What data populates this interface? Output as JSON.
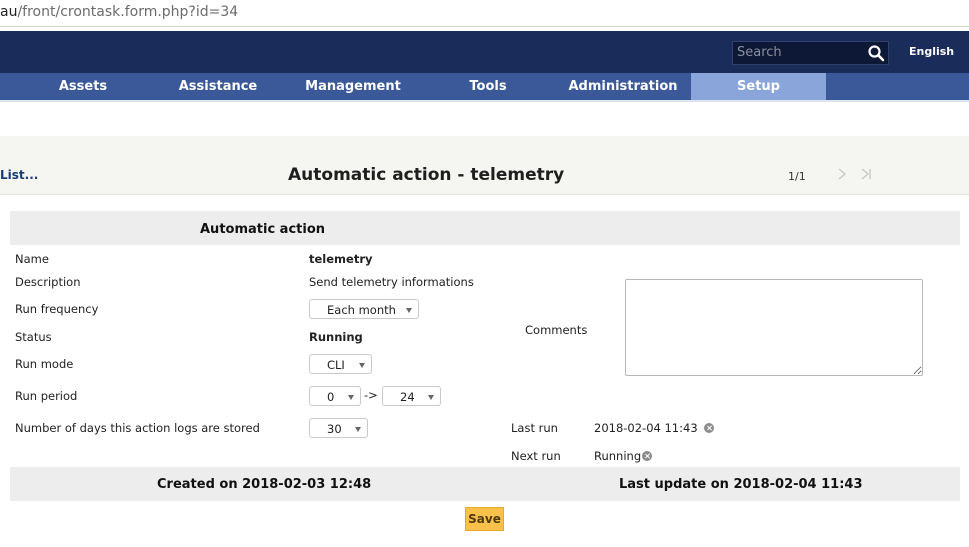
{
  "browser": {
    "url_host": "au",
    "url_path": "/front/crontask.form.php?id=34"
  },
  "header": {
    "search_placeholder": "Search",
    "language": "English",
    "search_icon": "magnifier-icon"
  },
  "menu": {
    "items": [
      {
        "label": "Assets",
        "active": false
      },
      {
        "label": "Assistance",
        "active": false
      },
      {
        "label": "Management",
        "active": false
      },
      {
        "label": "Tools",
        "active": false
      },
      {
        "label": "Administration",
        "active": false
      },
      {
        "label": "Setup",
        "active": true
      }
    ],
    "active_color": "#8aa5d9"
  },
  "titlebar": {
    "list_link": "List...",
    "title": "Automatic action - telemetry",
    "pager": "1/1"
  },
  "form": {
    "header": "Automatic action",
    "name_label": "Name",
    "name_value": "telemetry",
    "description_label": "Description",
    "description_value": "Send telemetry informations",
    "run_frequency_label": "Run frequency",
    "run_frequency_value": "Each month",
    "status_label": "Status",
    "status_value": "Running",
    "run_mode_label": "Run mode",
    "run_mode_value": "CLI",
    "run_period_label": "Run period",
    "run_period_from": "0",
    "run_period_arrow": "->",
    "run_period_to": "24",
    "log_days_label": "Number of days this action logs are stored",
    "log_days_value": "30",
    "comments_label": "Comments",
    "comments_value": "",
    "last_run_label": "Last run",
    "last_run_value": "2018-02-04 11:43",
    "next_run_label": "Next run",
    "next_run_value": "Running"
  },
  "footer": {
    "created": "Created on 2018-02-03 12:48",
    "updated": "Last update on 2018-02-04 11:43",
    "save_label": "Save"
  },
  "colors": {
    "top_header": "#1a2c59",
    "menu_bar": "#3b5998",
    "save_button": "#f9c04a"
  }
}
